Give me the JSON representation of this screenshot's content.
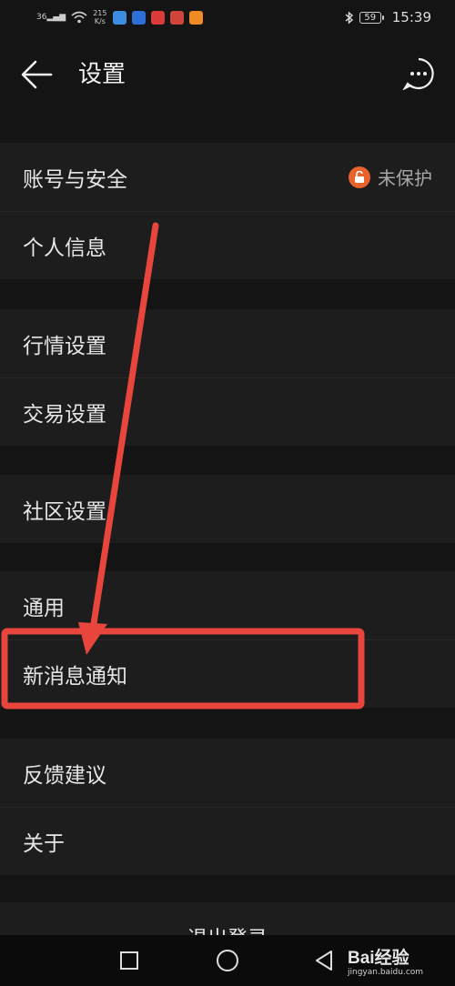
{
  "status": {
    "speed_value": "215",
    "speed_unit": "K/s",
    "network": "36",
    "battery": "59",
    "time": "15:39"
  },
  "header": {
    "title": "设置"
  },
  "sections": [
    {
      "items": [
        {
          "label": "账号与安全",
          "badge": "未保护"
        },
        {
          "label": "个人信息"
        }
      ]
    },
    {
      "items": [
        {
          "label": "行情设置"
        },
        {
          "label": "交易设置"
        }
      ]
    },
    {
      "items": [
        {
          "label": "社区设置"
        }
      ]
    },
    {
      "items": [
        {
          "label": "通用"
        },
        {
          "label": "新消息通知"
        }
      ]
    },
    {
      "items": [
        {
          "label": "反馈建议"
        },
        {
          "label": "关于"
        }
      ]
    }
  ],
  "logout_label": "退出登录",
  "watermark": {
    "brand": "Bai经验",
    "url": "jingyan.baidu.com"
  },
  "colors": {
    "background": "#141414",
    "row_background": "#1d1d1d",
    "lock_badge": "#e8632c",
    "annotation": "#e8463c"
  }
}
